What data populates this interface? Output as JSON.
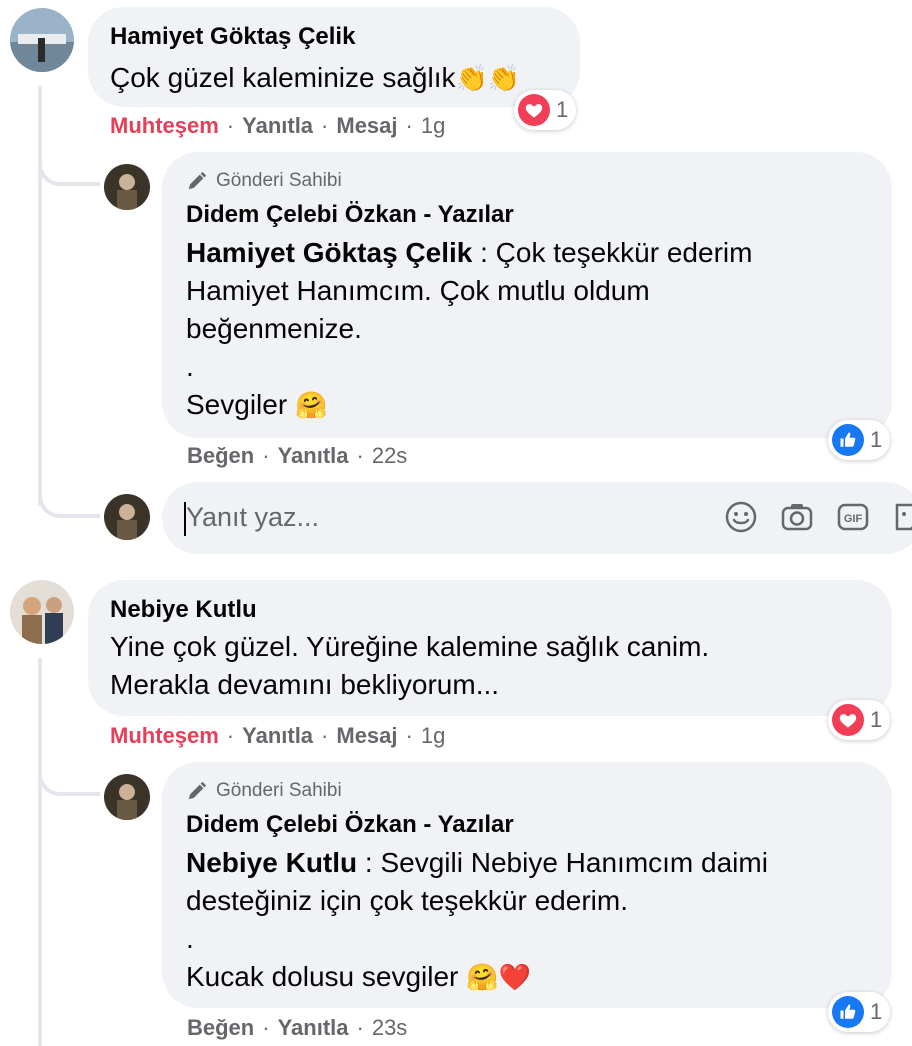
{
  "comments": [
    {
      "author": "Hamiyet Göktaş Çelik",
      "text": "Çok güzel kaleminize sağlık",
      "reaction_label": "Muhteşem",
      "reply_label": "Yanıtla",
      "message_label": "Mesaj",
      "time": "1g",
      "reaction_count": "1",
      "reaction_type": "heart",
      "emoji": "👏👏",
      "reply": {
        "owner_badge": "Gönderi Sahibi",
        "author": "Didem Çelebi Özkan - Yazılar",
        "mention": "Hamiyet Göktaş Çelik",
        "text_line1": " : Çok teşekkür ederim",
        "text_line2": "Hamiyet Hanımcım. Çok mutlu oldum",
        "text_line3": "beğenmenize.",
        "text_line4": ".",
        "text_line5": "Sevgiler",
        "emoji": "🤗",
        "like_label": "Beğen",
        "reply_label": "Yanıtla",
        "time": "22s",
        "reaction_count": "1",
        "reaction_type": "like"
      },
      "reply_input_placeholder": "Yanıt yaz..."
    },
    {
      "author": "Nebiye Kutlu",
      "text_line1": "Yine çok güzel. Yüreğine kalemine sağlık canim.",
      "text_line2": "Merakla devamını bekliyorum...",
      "reaction_label": "Muhteşem",
      "reply_label": "Yanıtla",
      "message_label": "Mesaj",
      "time": "1g",
      "reaction_count": "1",
      "reaction_type": "heart",
      "reply": {
        "owner_badge": "Gönderi Sahibi",
        "author": "Didem Çelebi Özkan - Yazılar",
        "mention": "Nebiye Kutlu",
        "text_line1": " : Sevgili Nebiye Hanımcım daimi",
        "text_line2": "desteğiniz için çok teşekkür ederim.",
        "text_line3": ".",
        "text_line4": "Kucak dolusu sevgiler",
        "emoji": "🤗❤️",
        "like_label": "Beğen",
        "reply_label": "Yanıtla",
        "time": "23s",
        "reaction_count": "1",
        "reaction_type": "like"
      }
    }
  ],
  "input_tools": [
    "emoji-icon",
    "camera-icon",
    "gif-icon",
    "sticker-icon"
  ],
  "colors": {
    "bubble": "#f0f2f5",
    "muted": "#65676b",
    "love_red": "#e4405a",
    "like_blue": "#1877f2"
  }
}
